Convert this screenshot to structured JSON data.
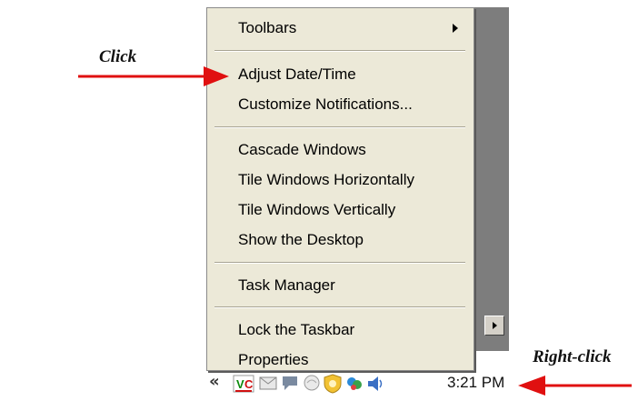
{
  "menu": {
    "items": [
      {
        "label": "Toolbars"
      },
      {
        "label": "Adjust Date/Time"
      },
      {
        "label": "Customize Notifications..."
      },
      {
        "label": "Cascade Windows"
      },
      {
        "label": "Tile Windows Horizontally"
      },
      {
        "label": "Tile Windows Vertically"
      },
      {
        "label": "Show the Desktop"
      },
      {
        "label": "Task Manager"
      },
      {
        "label": "Lock the Taskbar"
      },
      {
        "label": "Properties"
      }
    ]
  },
  "tray": {
    "chevron": "«",
    "clock": "3:21 PM",
    "icons": [
      "vc-icon",
      "email-icon",
      "chat-icon",
      "network-icon",
      "shield-icon",
      "messenger-icon",
      "volume-icon"
    ]
  },
  "annotations": {
    "click_label": "Click",
    "right_click_label": "Right-click",
    "arrow_color": "#e01010"
  }
}
